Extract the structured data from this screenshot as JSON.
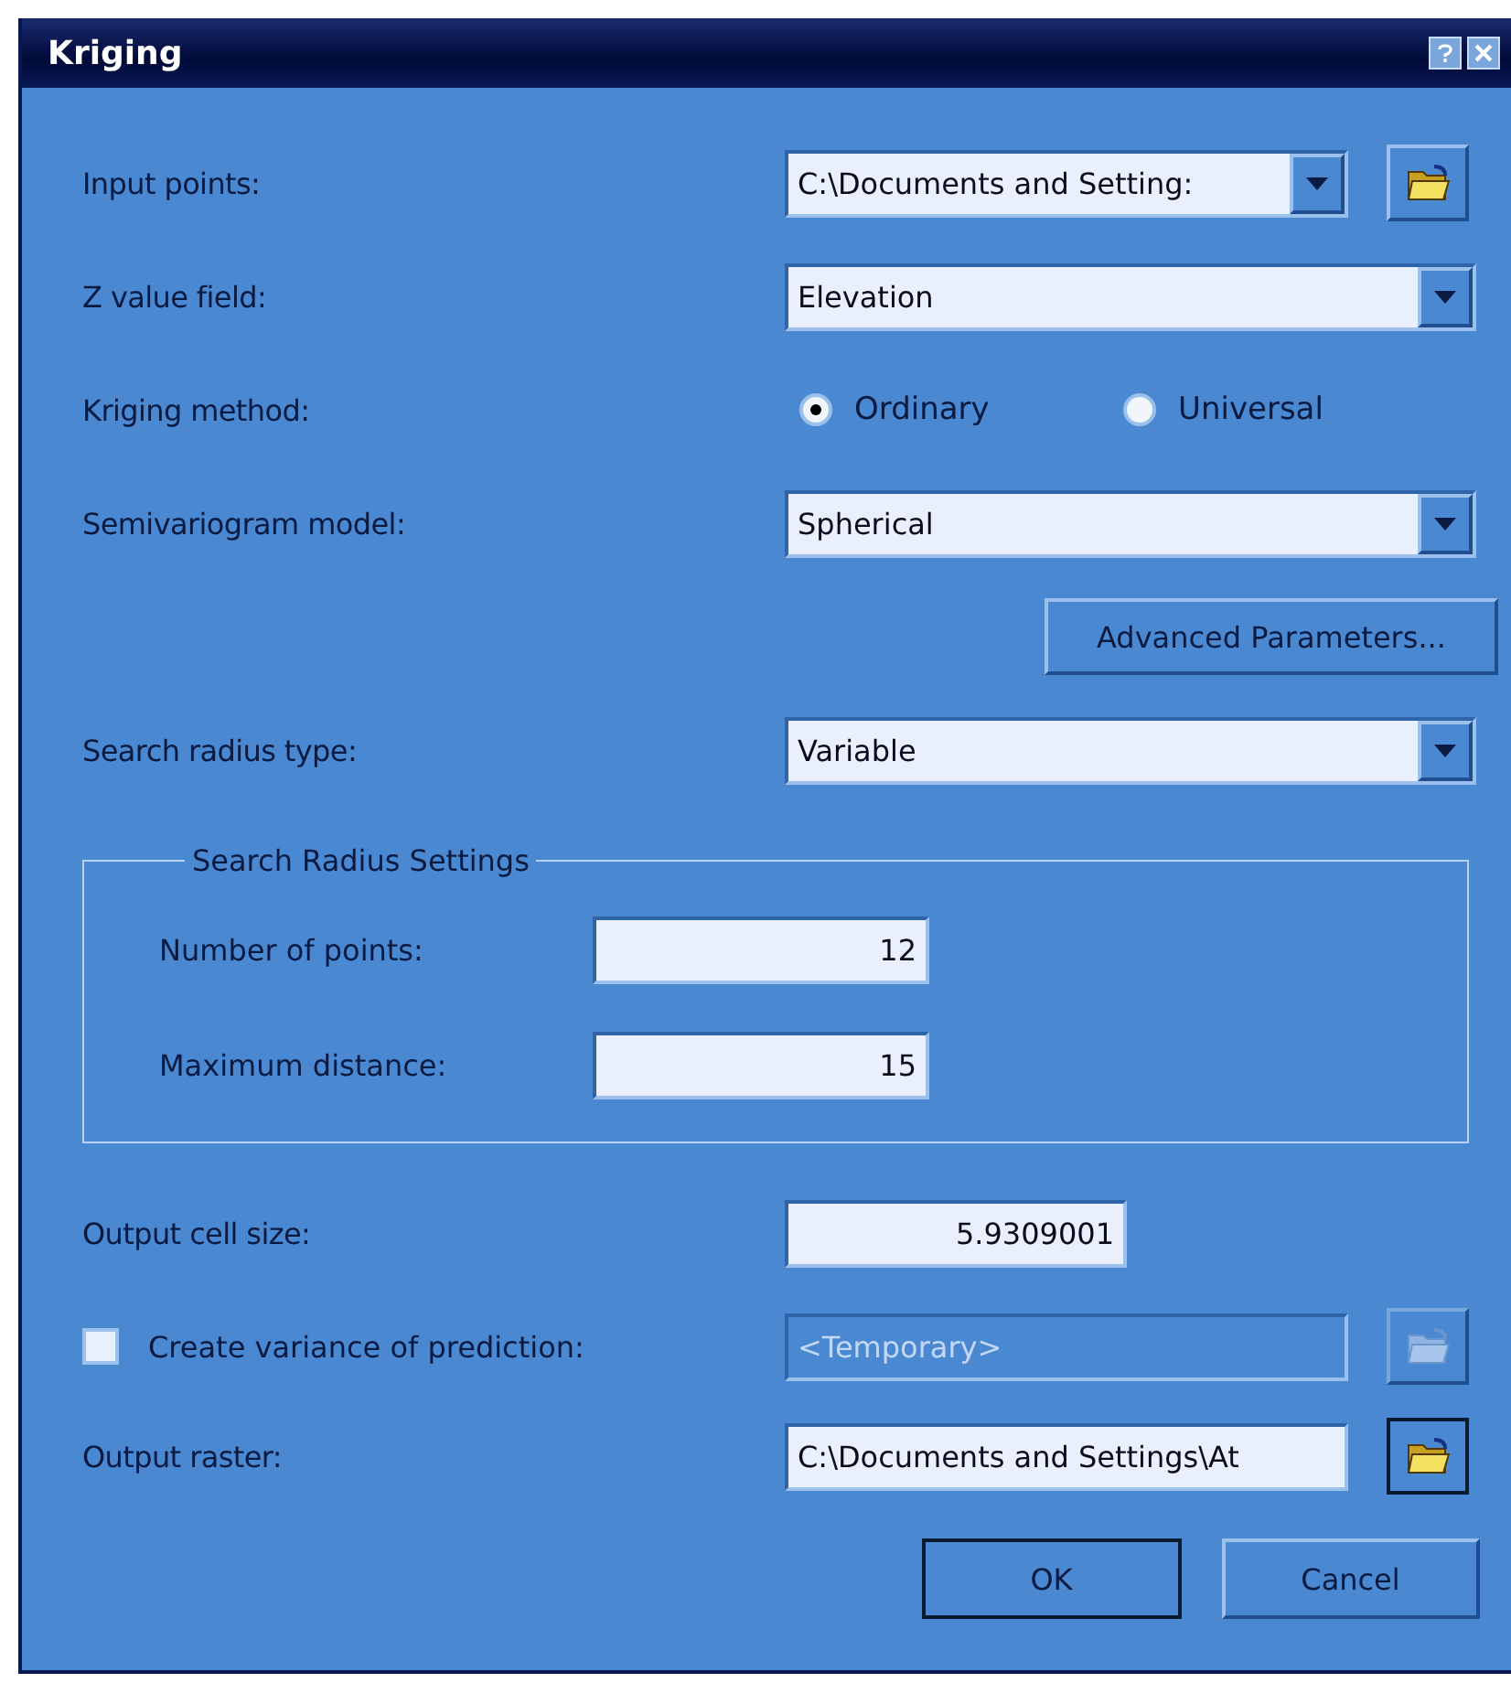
{
  "window": {
    "title": "Kriging"
  },
  "rows": [
    {
      "kind": "combo",
      "label": "Input points:",
      "value": "C:\\Documents and Setting:",
      "browse": true
    },
    {
      "kind": "combo",
      "label": "Z value field:",
      "value": "Elevation",
      "browse": false
    },
    {
      "kind": "radio",
      "label": "Kriging method:",
      "options": [
        {
          "label": "Ordinary",
          "selected": true
        },
        {
          "label": "Universal",
          "selected": false
        }
      ]
    },
    {
      "kind": "combo",
      "label": "Semivariogram model:",
      "value": "Spherical",
      "browse": false
    },
    {
      "kind": "button",
      "label": "Advanced Parameters..."
    },
    {
      "kind": "combo",
      "label": "Search radius type:",
      "value": "Variable",
      "browse": false
    }
  ],
  "group": {
    "title": "Search Radius Settings",
    "fields": [
      {
        "label": "Number of points:",
        "value": "12"
      },
      {
        "label": "Maximum distance:",
        "value": "15"
      }
    ]
  },
  "output_cell_size": {
    "label": "Output cell size:",
    "value": "5.9309001"
  },
  "variance": {
    "label": "Create variance of prediction:",
    "checked": false,
    "placeholder": "<Temporary>",
    "disabled": true
  },
  "output_raster": {
    "label": "Output raster:",
    "value": "C:\\Documents and Settings\\At"
  },
  "buttons": [
    {
      "label": "OK",
      "default": true
    },
    {
      "label": "Cancel",
      "default": false
    }
  ]
}
